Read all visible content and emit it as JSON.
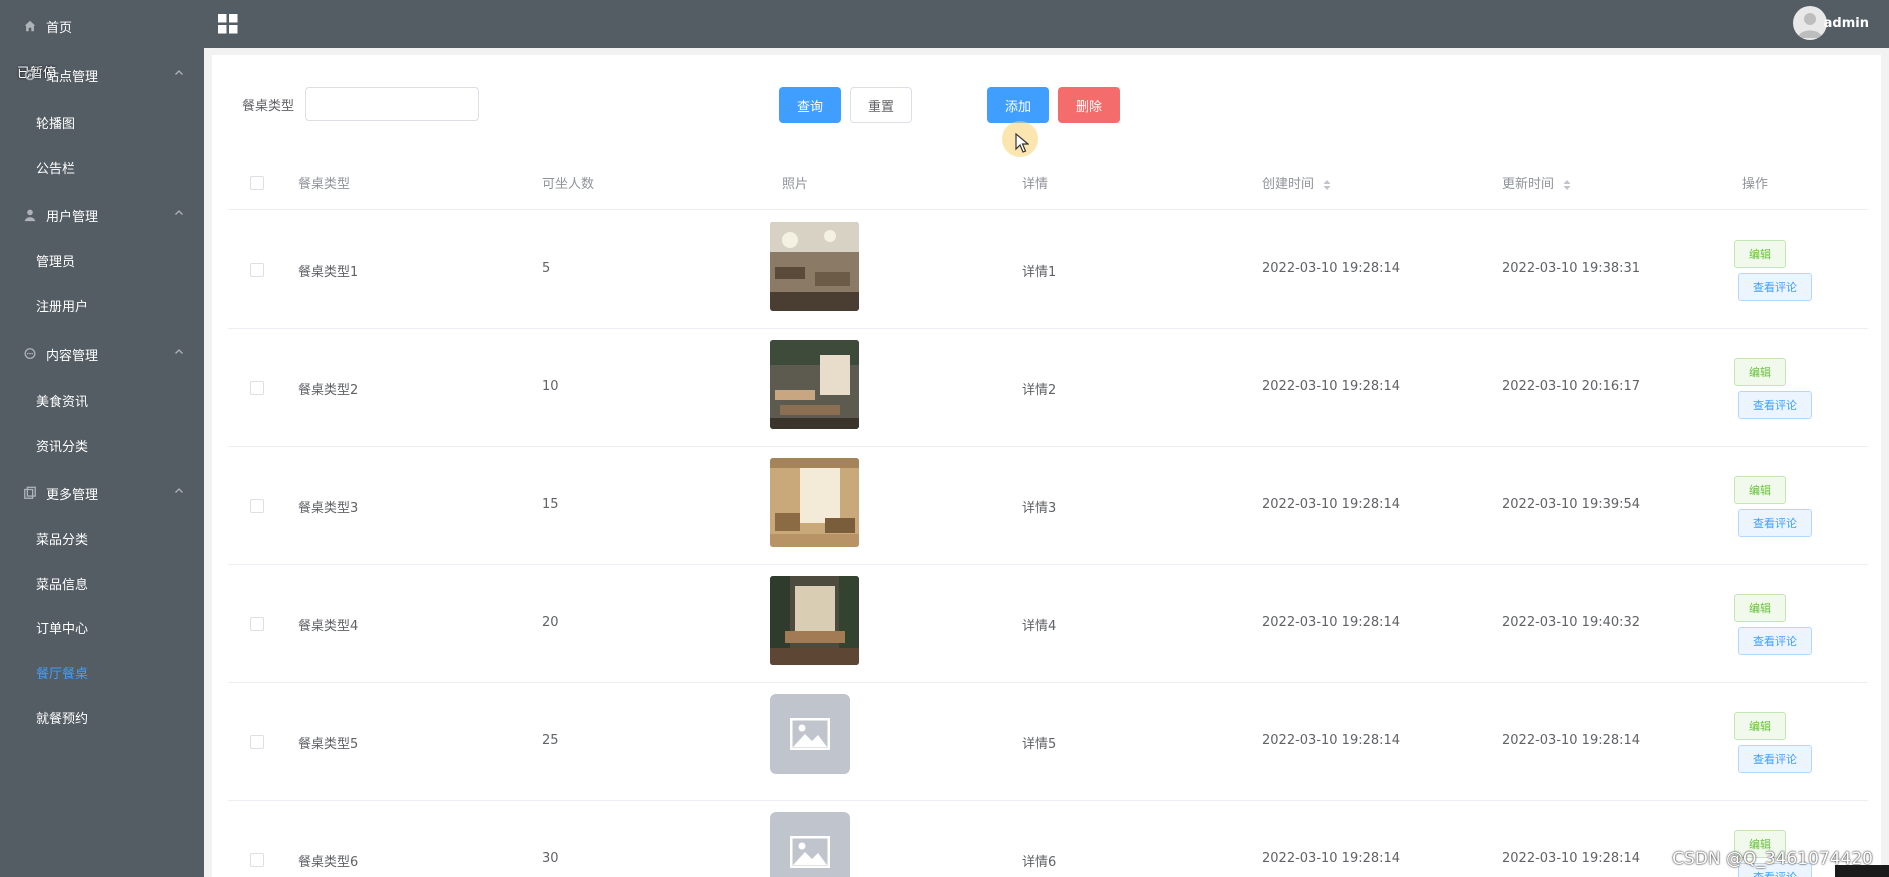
{
  "sidebar": {
    "paused_badge": "已暂停",
    "items": [
      {
        "type": "item",
        "label": "首页",
        "icon": "home-icon"
      },
      {
        "type": "group",
        "label": "站点管理",
        "icon": "gear-icon"
      },
      {
        "type": "sub",
        "label": "轮播图"
      },
      {
        "type": "sub",
        "label": "公告栏"
      },
      {
        "type": "group",
        "label": "用户管理",
        "icon": "user-icon"
      },
      {
        "type": "sub",
        "label": "管理员"
      },
      {
        "type": "sub",
        "label": "注册用户"
      },
      {
        "type": "group",
        "label": "内容管理",
        "icon": "chat-icon"
      },
      {
        "type": "sub",
        "label": "美食资讯"
      },
      {
        "type": "sub",
        "label": "资讯分类"
      },
      {
        "type": "group",
        "label": "更多管理",
        "icon": "copy-icon"
      },
      {
        "type": "sub",
        "label": "菜品分类"
      },
      {
        "type": "sub",
        "label": "菜品信息"
      },
      {
        "type": "sub",
        "label": "订单中心"
      },
      {
        "type": "sub",
        "label": "餐厅餐桌",
        "active": true
      },
      {
        "type": "sub",
        "label": "就餐预约"
      }
    ]
  },
  "header": {
    "user": "admin"
  },
  "search": {
    "label": "餐桌类型",
    "value": "",
    "placeholder": ""
  },
  "toolbar": {
    "query": "查询",
    "reset": "重置",
    "add": "添加",
    "delete": "删除"
  },
  "table": {
    "columns": [
      "餐桌类型",
      "可坐人数",
      "照片",
      "详情",
      "创建时间",
      "更新时间",
      "操作"
    ],
    "edit_label": "编辑",
    "review_label": "查看评论",
    "rows": [
      {
        "type": "餐桌类型1",
        "seats": "5",
        "photo": "restaurant-photo-1",
        "detail": "详情1",
        "created": "2022-03-10 19:28:14",
        "updated": "2022-03-10 19:38:31"
      },
      {
        "type": "餐桌类型2",
        "seats": "10",
        "photo": "restaurant-photo-2",
        "detail": "详情2",
        "created": "2022-03-10 19:28:14",
        "updated": "2022-03-10 20:16:17"
      },
      {
        "type": "餐桌类型3",
        "seats": "15",
        "photo": "restaurant-photo-3",
        "detail": "详情3",
        "created": "2022-03-10 19:28:14",
        "updated": "2022-03-10 19:39:54"
      },
      {
        "type": "餐桌类型4",
        "seats": "20",
        "photo": "restaurant-photo-4",
        "detail": "详情4",
        "created": "2022-03-10 19:28:14",
        "updated": "2022-03-10 19:40:32"
      },
      {
        "type": "餐桌类型5",
        "seats": "25",
        "photo": "image-placeholder-icon",
        "detail": "详情5",
        "created": "2022-03-10 19:28:14",
        "updated": "2022-03-10 19:28:14"
      },
      {
        "type": "餐桌类型6",
        "seats": "30",
        "photo": "image-placeholder-icon",
        "detail": "详情6",
        "created": "2022-03-10 19:28:14",
        "updated": "2022-03-10 19:28:14"
      }
    ]
  },
  "watermark": "CSDN @Q_3461074420",
  "colors": {
    "sidebar": "#545c64",
    "primary": "#409EFF",
    "danger": "#F56C6C",
    "success": "#67C23A"
  }
}
